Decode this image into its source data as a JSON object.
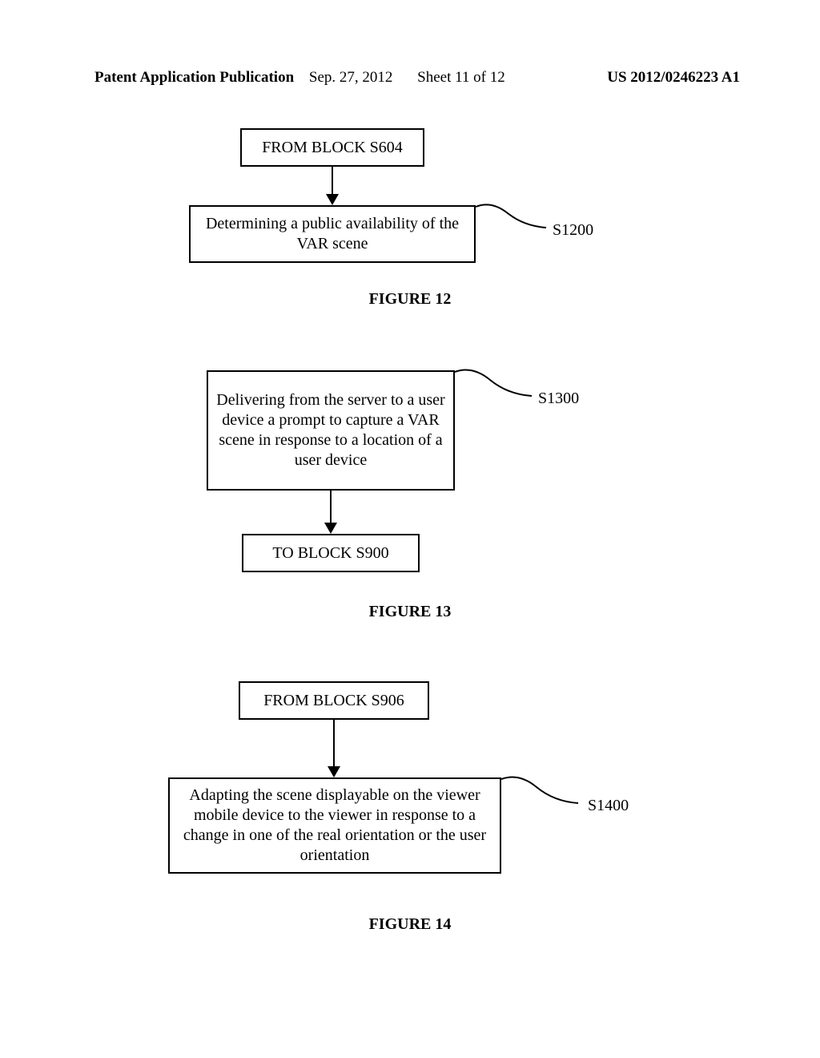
{
  "header": {
    "pubtype": "Patent Application Publication",
    "pubdate": "Sep. 27, 2012",
    "sheet": "Sheet 11 of 12",
    "pubno": "US 2012/0246223 A1"
  },
  "fig12": {
    "from_block": "FROM BLOCK S604",
    "step": "Determining a public availability of the VAR scene",
    "ref": "S1200",
    "caption": "FIGURE 12"
  },
  "fig13": {
    "step": "Delivering from the server to a user device a prompt to capture a VAR scene in response to a location of a user device",
    "ref": "S1300",
    "to_block": "TO BLOCK S900",
    "caption": "FIGURE 13"
  },
  "fig14": {
    "from_block": "FROM BLOCK S906",
    "step": "Adapting the scene displayable on the viewer mobile device to the viewer in response to a change in one of the real orientation or the user orientation",
    "ref": "S1400",
    "caption": "FIGURE 14"
  }
}
